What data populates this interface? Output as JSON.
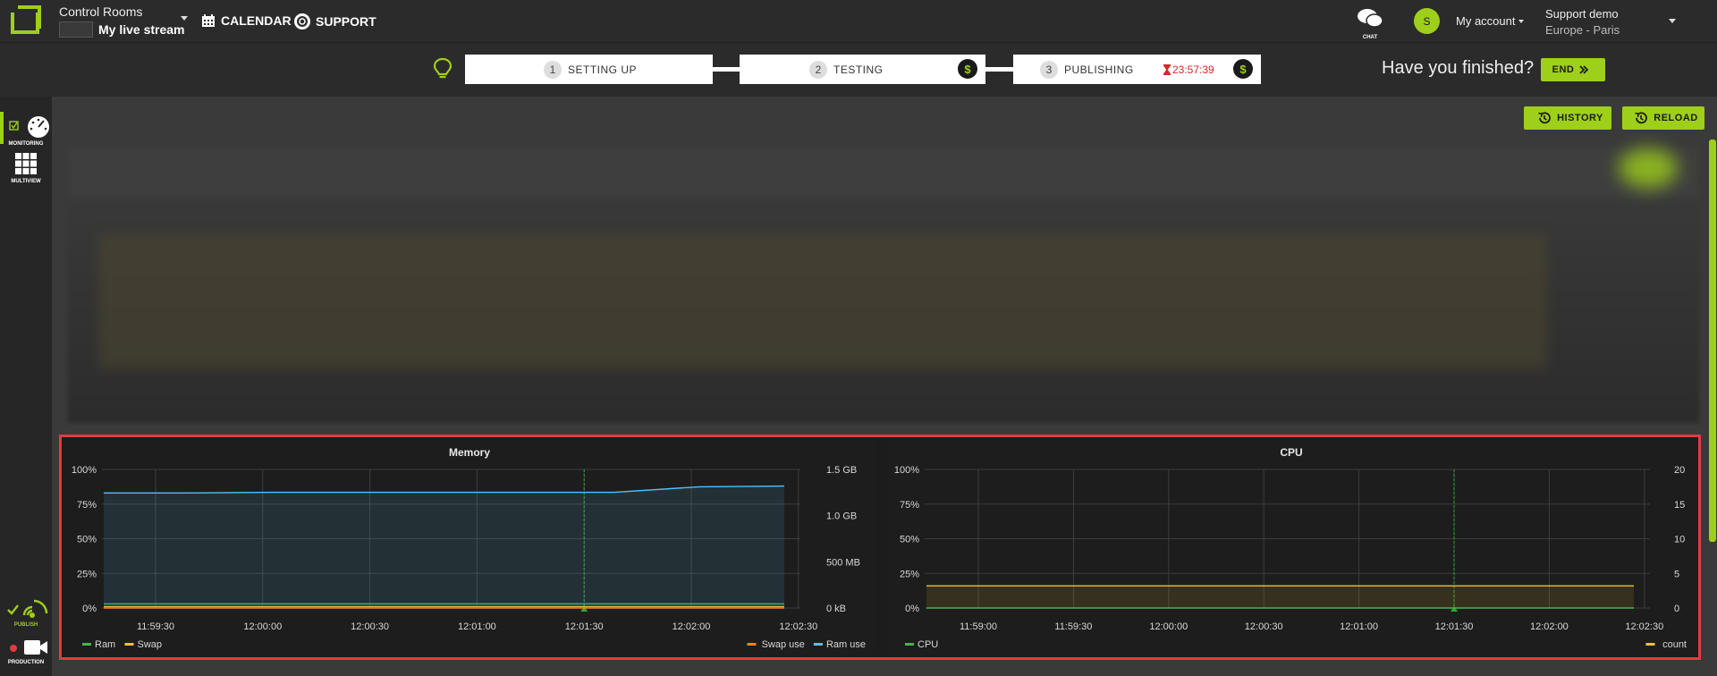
{
  "header": {
    "app_title": "Control Rooms",
    "stream_name": "My live stream",
    "calendar_label": "CALENDAR",
    "support_label": "SUPPORT",
    "chat_label": "CHAT",
    "avatar_initial": "S",
    "account_label": "My account",
    "org_name": "Support demo",
    "timezone": "Europe - Paris"
  },
  "steps": [
    {
      "num": "1",
      "label": "SETTING UP"
    },
    {
      "num": "2",
      "label": "TESTING"
    },
    {
      "num": "3",
      "label": "PUBLISHING"
    }
  ],
  "timer": "23:57:39",
  "dollar_symbol": "$",
  "finished_text": "Have you finished?",
  "end_label": "END",
  "history_label": "HISTORY",
  "reload_label": "RELOAD",
  "sidebar": {
    "monitoring": "MONITORING",
    "multiview": "MULTIVIEW",
    "publish": "PUBLISH",
    "production": "PRODUCTION"
  },
  "chart_data": [
    {
      "type": "area",
      "title": "Memory",
      "x": [
        "11:59:30",
        "12:00:00",
        "12:00:30",
        "12:01:00",
        "12:01:30",
        "12:02:00",
        "12:02:30"
      ],
      "y_left_ticks": [
        "100%",
        "75%",
        "50%",
        "25%",
        "0%"
      ],
      "y_right_ticks": [
        "1.5 GB",
        "1.0 GB",
        "500 MB",
        "0 kB"
      ],
      "ylim": [
        0,
        100
      ],
      "series": [
        {
          "name": "Ram",
          "color": "#4caf50",
          "axis": "left",
          "values": [
            3,
            3,
            3,
            3,
            3,
            3,
            3,
            3
          ]
        },
        {
          "name": "Swap",
          "color": "#f2c12e",
          "axis": "left",
          "values": [
            1,
            1,
            1,
            1,
            1,
            1,
            1,
            1
          ]
        },
        {
          "name": "Swap use",
          "color": "#f57c2b",
          "axis": "right",
          "values": [
            0,
            0,
            0,
            0,
            0,
            0,
            0,
            0
          ]
        },
        {
          "name": "Ram use",
          "color": "#4fc3f7",
          "axis": "right",
          "values": [
            83,
            83,
            83.5,
            83.5,
            83.5,
            83.5,
            83.5,
            87.5,
            88
          ]
        }
      ],
      "legend_left": [
        "Ram",
        "Swap"
      ],
      "legend_right": [
        "Swap use",
        "Ram use"
      ],
      "marker_time": "12:01:30"
    },
    {
      "type": "area",
      "title": "CPU",
      "x": [
        "11:59:00",
        "11:59:30",
        "12:00:00",
        "12:00:30",
        "12:01:00",
        "12:01:30",
        "12:02:00",
        "12:02:30"
      ],
      "y_left_ticks": [
        "100%",
        "75%",
        "50%",
        "25%",
        "0%"
      ],
      "y_right_ticks": [
        "20",
        "15",
        "10",
        "5",
        "0"
      ],
      "ylim": [
        0,
        100
      ],
      "series": [
        {
          "name": "CPU",
          "color": "#4caf50",
          "axis": "left",
          "values": [
            0,
            0,
            0,
            0,
            0,
            0,
            0,
            0
          ]
        },
        {
          "name": "count",
          "color": "#f2c12e",
          "axis": "right",
          "values": [
            16,
            16,
            16,
            16,
            16,
            16,
            16,
            16
          ]
        }
      ],
      "legend_left": [
        "CPU"
      ],
      "legend_right": [
        "count"
      ],
      "marker_time": "12:01:30"
    }
  ]
}
